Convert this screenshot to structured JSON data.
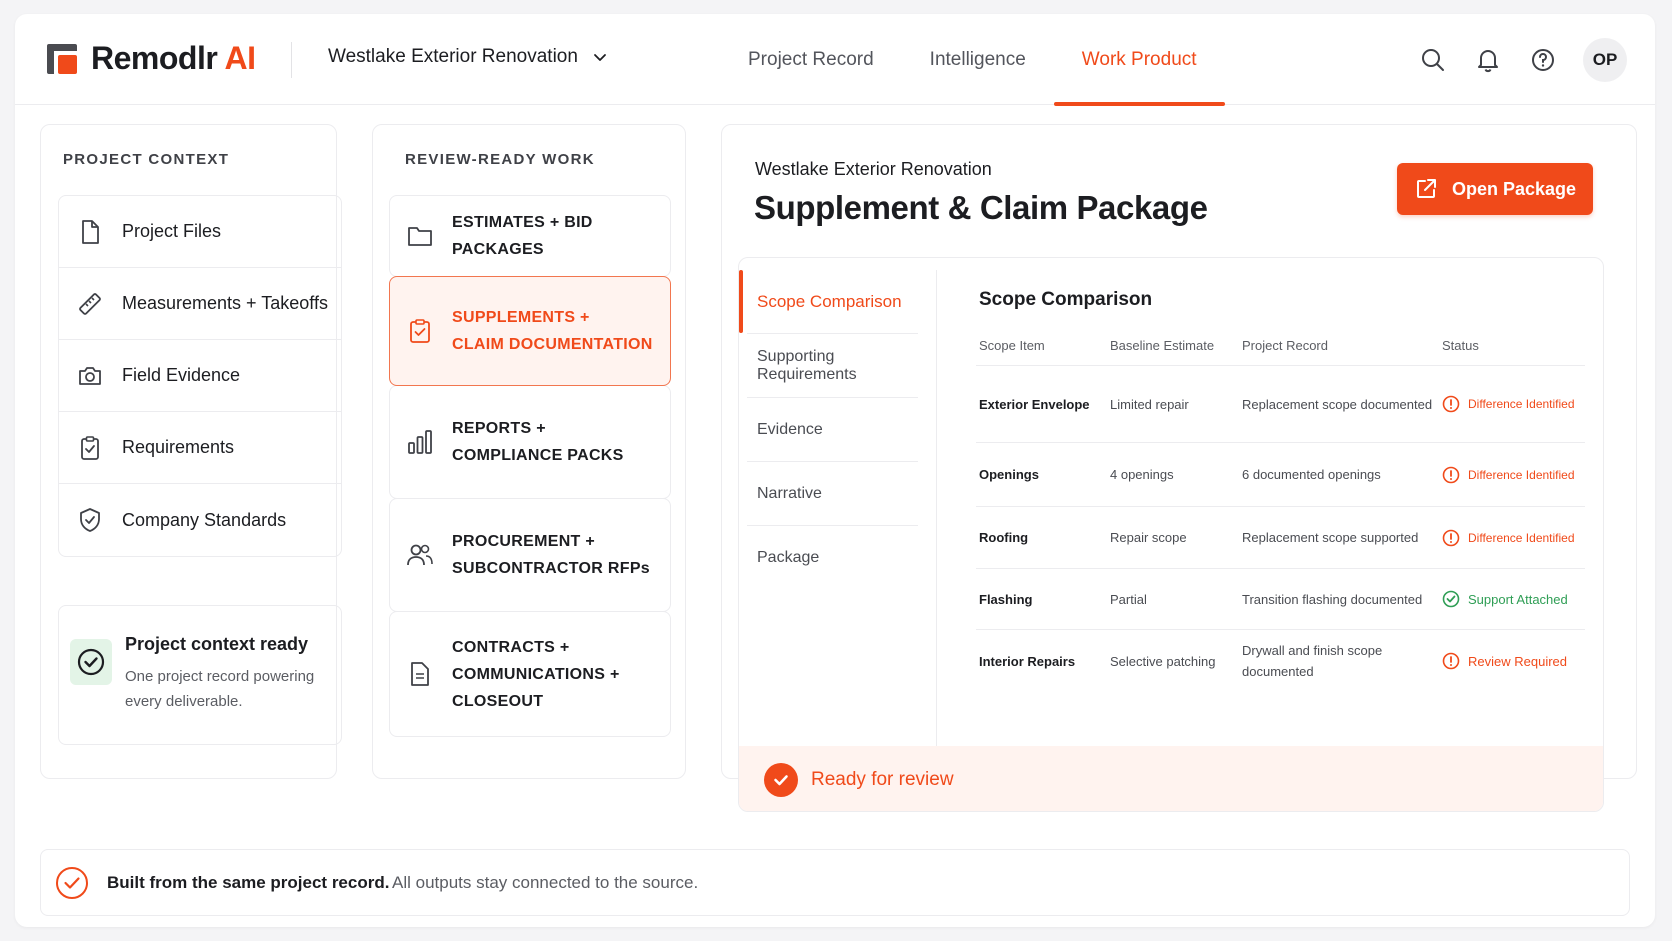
{
  "brand": {
    "name": "Remodlr",
    "suffix": "AI",
    "accent": "#f04a1a"
  },
  "project_selector": {
    "value": "Westlake Exterior Renovation"
  },
  "nav": {
    "items": [
      {
        "label": "Project Record"
      },
      {
        "label": "Intelligence"
      },
      {
        "label": "Work Product",
        "active": true
      }
    ]
  },
  "user": {
    "initials": "OP"
  },
  "project_context": {
    "title": "PROJECT CONTEXT",
    "items": [
      {
        "label": "Project Files",
        "icon": "file-icon"
      },
      {
        "label": "Measurements + Takeoffs",
        "icon": "ruler-icon"
      },
      {
        "label": "Field Evidence",
        "icon": "camera-icon"
      },
      {
        "label": "Requirements",
        "icon": "clipboard-check-icon"
      },
      {
        "label": "Company Standards",
        "icon": "shield-check-icon"
      }
    ],
    "ready": {
      "title": "Project context ready",
      "description": "One project record powering every deliverable."
    }
  },
  "review_ready": {
    "title": "REVIEW-READY WORK",
    "items": [
      {
        "line1": "ESTIMATES + BID PACKAGES",
        "line2": "",
        "line3": "",
        "icon": "folder-icon"
      },
      {
        "line1": "SUPPLEMENTS +",
        "line2": "CLAIM DOCUMENTATION",
        "line3": "",
        "icon": "clipboard-check-icon",
        "active": true
      },
      {
        "line1": "REPORTS +",
        "line2": "COMPLIANCE PACKS",
        "line3": "",
        "icon": "bar-chart-icon"
      },
      {
        "line1": "PROCUREMENT +",
        "line2": "SUBCONTRACTOR RFPs",
        "line3": "",
        "icon": "users-icon"
      },
      {
        "line1": "CONTRACTS +",
        "line2": "COMMUNICATIONS +",
        "line3": "CLOSEOUT",
        "icon": "document-icon"
      }
    ]
  },
  "package": {
    "project": "Westlake Exterior Renovation",
    "title": "Supplement & Claim Package",
    "open_button": "Open Package",
    "subnav": [
      {
        "label": "Scope Comparison",
        "active": true
      },
      {
        "label": "Supporting Requirements"
      },
      {
        "label": "Evidence"
      },
      {
        "label": "Narrative"
      },
      {
        "label": "Package"
      }
    ],
    "scope_title": "Scope Comparison",
    "columns": [
      "Scope Item",
      "Baseline Estimate",
      "Project Record",
      "Status"
    ],
    "rows": [
      {
        "item": "Exterior Envelope",
        "baseline": "Limited repair",
        "record": "Replacement scope documented",
        "status": "Difference Identified",
        "kind": "diff"
      },
      {
        "item": "Openings",
        "baseline": "4 openings",
        "record": "6 documented openings",
        "status": "Difference Identified",
        "kind": "diff"
      },
      {
        "item": "Roofing",
        "baseline": "Repair scope",
        "record": "Replacement scope supported",
        "status": "Difference Identified",
        "kind": "diff"
      },
      {
        "item": "Flashing",
        "baseline": "Partial",
        "record": "Transition flashing documented",
        "status": "Support Attached",
        "kind": "ok"
      },
      {
        "item": "Interior Repairs",
        "baseline": "Selective patching",
        "record": "Drywall and finish scope documented",
        "status": "Review Required",
        "kind": "review"
      }
    ],
    "ready_label": "Ready for review"
  },
  "footer": {
    "bold": "Built from the same project record.",
    "text": "All outputs stay connected to the source."
  },
  "colors": {
    "accent": "#f04a1a",
    "success": "#2f9e55",
    "accent_soft": "#fff3ef"
  }
}
